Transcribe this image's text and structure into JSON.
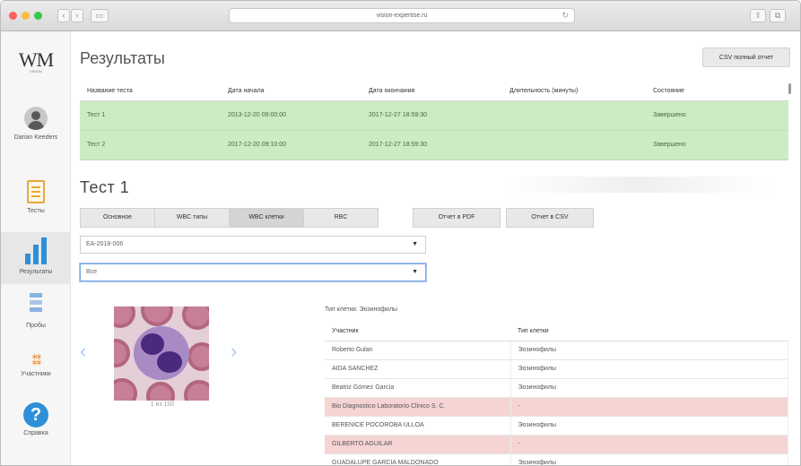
{
  "browser": {
    "url": "vision-expertise.ru",
    "back": "‹",
    "forward": "›",
    "sidebar_toggle": "▭",
    "reload": "↻",
    "share": "⇧",
    "tabs": "⧉"
  },
  "sidebar": {
    "logo": "WM",
    "logo_sub": "VISION",
    "user_name": "Darian Keeders",
    "items": [
      {
        "label": "Тесты",
        "icon": "document-icon"
      },
      {
        "label": "Результаты",
        "icon": "bar-chart-icon"
      },
      {
        "label": "Пробы",
        "icon": "samples-icon"
      },
      {
        "label": "Участники",
        "icon": "people-icon"
      },
      {
        "label": "Справка",
        "icon": "help-icon"
      }
    ]
  },
  "header": {
    "title": "Результаты",
    "csv_all_button": "CSV полный отчет"
  },
  "results_table": {
    "columns": [
      "Название теста",
      "Дата начала",
      "Дата окончания",
      "Длительность (минуты)",
      "Состояние"
    ],
    "rows": [
      [
        "Тест 1",
        "2013-12-20 09:00:00",
        "2017-12-27 18:59:30",
        "",
        "Завершено"
      ],
      [
        "Тест 2",
        "2017-12-20 09:10:00",
        "2017-12-27 18:59:30",
        "",
        "Завершено"
      ]
    ]
  },
  "test_detail": {
    "title": "Тест 1",
    "tabs": [
      "Основное",
      "WBC типы",
      "WBC клетки",
      "RBC"
    ],
    "active_tab": "WBC клетки",
    "report_pdf": "Отчет в PDF",
    "report_csv": "Отчет в CSV",
    "select_sample": "EA-2018-006",
    "select_filter": "Все",
    "dropdown_arrow": "▼",
    "image_counter": "1 из 100",
    "prev_arrow": "‹",
    "next_arrow": "›"
  },
  "participants_table": {
    "cell_type_label": "Тип клетки: Эозинофилы",
    "columns": [
      "Участник",
      "Тип клетки"
    ],
    "rows": [
      {
        "name": "Roberto Gulan",
        "type": "Эозинофилы",
        "error": false
      },
      {
        "name": "AIDA SANCHEZ",
        "type": "Эозинофилы",
        "error": false
      },
      {
        "name": "Beatriz Gómez García",
        "type": "Эозинофилы",
        "error": false
      },
      {
        "name": "Bio Diagnostico Laboratorio Clinico S. C.",
        "type": "-",
        "error": true
      },
      {
        "name": "BERENICE POCOROBA ULLOA",
        "type": "Эозинофилы",
        "error": false
      },
      {
        "name": "GILBERTO AGUILAR",
        "type": "-",
        "error": true
      },
      {
        "name": "GUADALUPE GARCIA MALDONADO",
        "type": "Эозинофилы",
        "error": false
      }
    ]
  },
  "colors": {
    "success_row": "#cdebc5",
    "error_row": "#f6d4d4",
    "accent": "#2f8fd8"
  }
}
